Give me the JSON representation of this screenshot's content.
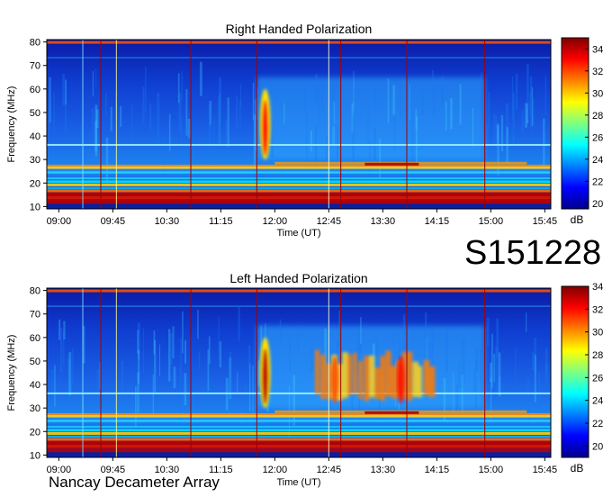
{
  "station_id": "S151228",
  "observatory": "Nancay Decameter Array",
  "chart_data": [
    {
      "type": "heatmap",
      "title": "Right Handed Polarization",
      "xlabel": "Time (UT)",
      "ylabel": "Frequency (MHz)",
      "colorbar_label": "dB",
      "x_ticks": [
        "09:00",
        "09:45",
        "10:30",
        "11:15",
        "12:00",
        "12:45",
        "13:30",
        "14:15",
        "15:00",
        "15:45"
      ],
      "x_range": [
        "08:50",
        "15:50"
      ],
      "y_ticks": [
        10,
        20,
        30,
        40,
        50,
        60,
        70,
        80
      ],
      "y_range": [
        9,
        81
      ],
      "colorbar_ticks": [
        20,
        22,
        24,
        26,
        28,
        30,
        32,
        34
      ],
      "colorbar_range": [
        19.5,
        35
      ],
      "colormap": "jet",
      "vertical_markers": [
        "09:35",
        "10:50",
        "11:45",
        "12:55",
        "13:50",
        "14:55"
      ],
      "bursts": [
        {
          "time": "11:52",
          "freq_range": [
            30,
            60
          ],
          "intensity_db": 33
        }
      ]
    },
    {
      "type": "heatmap",
      "title": "Left Handed Polarization",
      "xlabel": "Time (UT)",
      "ylabel": "Frequency (MHz)",
      "colorbar_label": "dB",
      "x_ticks": [
        "09:00",
        "09:45",
        "10:30",
        "11:15",
        "12:00",
        "12:45",
        "13:30",
        "14:15",
        "15:00",
        "15:45"
      ],
      "x_range": [
        "08:50",
        "15:50"
      ],
      "y_ticks": [
        10,
        20,
        30,
        40,
        50,
        60,
        70,
        80
      ],
      "y_range": [
        9,
        81
      ],
      "colorbar_ticks": [
        20,
        22,
        24,
        26,
        28,
        30,
        32,
        34
      ],
      "colorbar_range": [
        19,
        34
      ],
      "colormap": "jet",
      "vertical_markers": [
        "09:35",
        "10:50",
        "11:45",
        "12:55",
        "13:50",
        "14:55"
      ],
      "bursts": [
        {
          "time": "11:52",
          "freq_range": [
            30,
            60
          ],
          "intensity_db": 33
        },
        {
          "time": "12:50",
          "freq_range": [
            32,
            52
          ],
          "intensity_db": 31
        },
        {
          "time": "13:45",
          "freq_range": [
            32,
            52
          ],
          "intensity_db": 32
        }
      ]
    }
  ]
}
